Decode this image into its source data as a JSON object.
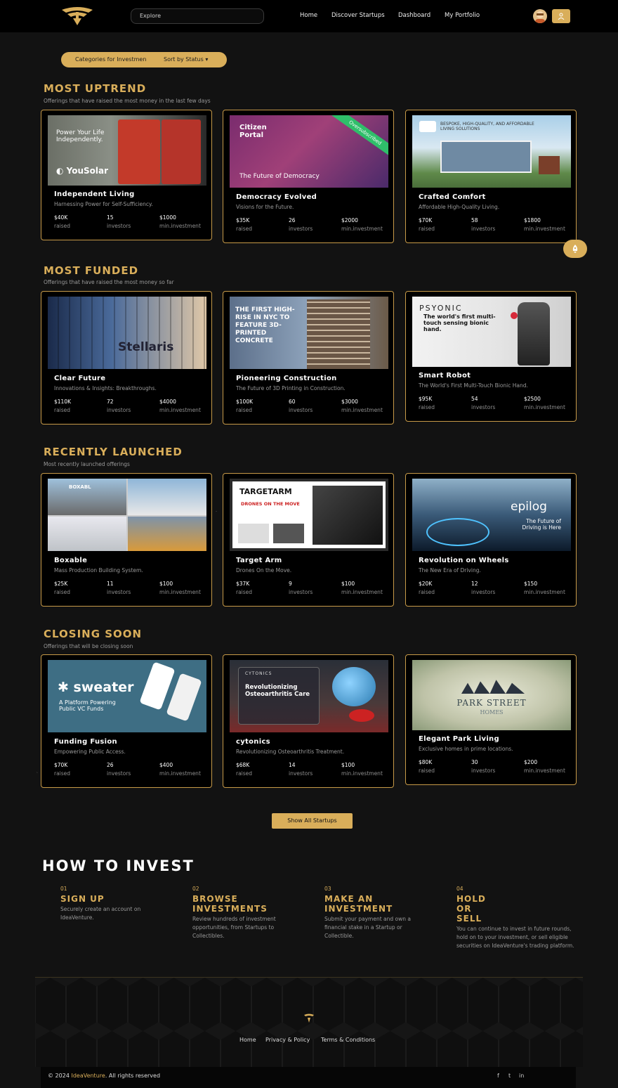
{
  "header": {
    "search_placeholder": "Explore",
    "nav": [
      "Home",
      "Discover Startups",
      "Dashboard",
      "My Portfolio"
    ]
  },
  "filters": {
    "category": "Categories for Investmen",
    "sort": "Sort by Status ▾"
  },
  "sections": [
    {
      "title": "MOST UPTREND",
      "subtitle": "Offerings that have raised the most money in the last few days",
      "cards": [
        {
          "name": "Independent Living",
          "tagline": "Harnessing Power for Self-Sufficiency.",
          "raised": "$40K",
          "investors": "15",
          "min": "$1000",
          "image_text": "Power Your Life Independently."
        },
        {
          "name": "Democracy Evolved",
          "tagline": "Visions for the Future.",
          "raised": "$35K",
          "investors": "26",
          "min": "$2000",
          "image_text": "The Future of Democracy",
          "ribbon": "Oversubscribed"
        },
        {
          "name": "Crafted Comfort",
          "tagline": "Affordable High-Quality Living.",
          "raised": "$70K",
          "investors": "58",
          "min": "$1800",
          "image_text": "BESPOKE, HIGH-QUALITY, AND AFFORDABLE LIVING SOLUTIONS"
        }
      ]
    },
    {
      "title": "MOST FUNDED",
      "subtitle": "Offerings that have raised the most money so far",
      "cards": [
        {
          "name": "Clear Future",
          "tagline": "Innovations & Insights: Breakthroughs.",
          "raised": "$110K",
          "investors": "72",
          "min": "$4000",
          "image_text": "Stellaris"
        },
        {
          "name": "Pioneering Construction",
          "tagline": "The Future of 3D Printing in Construction.",
          "raised": "$100K",
          "investors": "60",
          "min": "$3000",
          "image_text": "THE FIRST HIGH-RISE IN NYC TO FEATURE 3D-PRINTED CONCRETE"
        },
        {
          "name": "Smart Robot",
          "tagline": "The World's First Multi-Touch Bionic Hand.",
          "raised": "$95K",
          "investors": "54",
          "min": "$2500",
          "image_text": "The world's first multi-touch sensing bionic hand."
        }
      ]
    },
    {
      "title": "RECENTLY LAUNCHED",
      "subtitle": "Most recently launched offerings",
      "cards": [
        {
          "name": "Boxable",
          "tagline": "Mass Production Building System.",
          "raised": "$25K",
          "investors": "11",
          "min": "$100",
          "image_text": "BOXABL"
        },
        {
          "name": "Target Arm",
          "tagline": "Drones On the Move.",
          "raised": "$37K",
          "investors": "9",
          "min": "$100",
          "image_text": "DRONES ON THE MOVE"
        },
        {
          "name": "Revolution on Wheels",
          "tagline": "The New Era of Driving.",
          "raised": "$20K",
          "investors": "12",
          "min": "$150",
          "image_text": "The Future of Driving is Here"
        }
      ]
    },
    {
      "title": "CLOSING SOON",
      "subtitle": "Offerings that will be closing soon",
      "cards": [
        {
          "name": "Funding Fusion",
          "tagline": "Empowering Public Access.",
          "raised": "$70K",
          "investors": "26",
          "min": "$400",
          "image_text": "A Platform Powering Public VC Funds"
        },
        {
          "name": "cytonics",
          "tagline": "Revolutionizing Osteoarthritis Treatment.",
          "raised": "$68K",
          "investors": "14",
          "min": "$100",
          "image_text": "Revolutionizing Osteoarthritis Care"
        },
        {
          "name": "Elegant Park Living",
          "tagline": "Exclusive homes in prime locations.",
          "raised": "$80K",
          "investors": "30",
          "min": "$200",
          "image_text": "PARK STREET"
        }
      ]
    }
  ],
  "labels": {
    "raised": "raised",
    "investors": "investors",
    "min": "min.investment"
  },
  "show_all": "Show All Startups",
  "how": {
    "title": "HOW TO INVEST",
    "steps": [
      {
        "num": "01",
        "head": "SIGN UP",
        "text": "Securely create an account on IdeaVenture."
      },
      {
        "num": "02",
        "head": "BROWSE INVESTMENTS",
        "text": "Review hundreds of investment opportunities, from Startups to Collectibles."
      },
      {
        "num": "03",
        "head": "MAKE AN INVESTMENT",
        "text": "Submit your payment and own a financial stake in a Startup or Collectible."
      },
      {
        "num": "04",
        "head": "HOLD OR SELL",
        "text": "You can continue to invest in future rounds, hold on to your investment, or sell eligible securities on IdeaVenture's trading platform."
      }
    ]
  },
  "footer": {
    "links": [
      "Home",
      "Privacy & Policy",
      "Terms & Conditions"
    ],
    "copy_prefix": "© 2024 ",
    "brand": "IdeaVenture",
    "copy_suffix": ". All rights reserved",
    "social": [
      "f",
      "t",
      "in"
    ]
  },
  "colors": {
    "accent": "#d9ae5a",
    "background": "#121212",
    "card": "#000000"
  }
}
